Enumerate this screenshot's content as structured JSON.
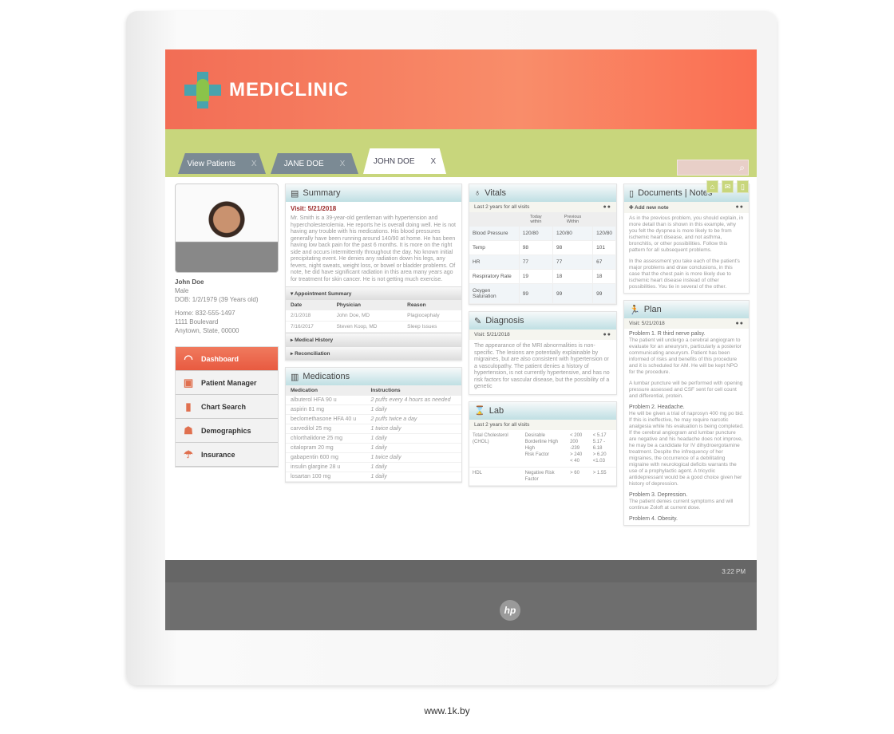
{
  "brand": {
    "name": "MEDICLINIC",
    "colors": {
      "header": "#f26d55",
      "band": "#c8d67c",
      "accent": "#4aa3ad"
    }
  },
  "tabs": [
    {
      "label": "View Patients",
      "close": "X"
    },
    {
      "label": "JANE DOE",
      "close": "X"
    },
    {
      "label": "JOHN DOE",
      "close": "X",
      "active": true
    }
  ],
  "search": {
    "placeholder": "",
    "icon": "search-icon"
  },
  "toolbar": {
    "icons": [
      "home-icon",
      "mail-icon",
      "trash-icon"
    ]
  },
  "patient": {
    "name": "John Doe",
    "sex": "Male",
    "dob": "DOB: 1/2/1979 (39 Years old)",
    "phone": "Home: 832-555-1497",
    "address1": "1111 Boulevard",
    "address2": "Anytown, State, 00000"
  },
  "nav": [
    {
      "label": "Dashboard",
      "icon": "gauge-icon",
      "active": true
    },
    {
      "label": "Patient Manager",
      "icon": "patient-manager-icon"
    },
    {
      "label": "Chart Search",
      "icon": "bar-chart-icon"
    },
    {
      "label": "Demographics",
      "icon": "people-icon"
    },
    {
      "label": "Insurance",
      "icon": "umbrella-icon"
    }
  ],
  "summary": {
    "title": "Summary",
    "visit": "Visit: 5/21/2018",
    "text": "Mr. Smith is a 39-year-old gentleman with hypertension and hypercholesterolemia. He reports he is overall doing well. He is not having any trouble with his medications. His blood pressures generally have been running around 140/90 at home. He has been having low back pain for the past 6 months. It is more on the right side and occurs intermittently throughout the day. No known initial precipitating event. He denies any radiation down his legs, any fevers, night sweats, weight loss, or bowel or bladder problems. Of note, he did have significant radiation in this area many years ago for treatment for skin cancer. He is not getting much exercise.",
    "appointments": {
      "title": "Appointment Summary",
      "columns": [
        "Date",
        "Physician",
        "Reason"
      ],
      "rows": [
        [
          "2/1/2018",
          "John Doe, MD",
          "Plagiocephaly"
        ],
        [
          "7/16/2017",
          "Steven Koop, MD",
          "Sleep Issues"
        ]
      ]
    },
    "medical_history": "Medical History",
    "reconciliation": "Reconciliation"
  },
  "medications": {
    "title": "Medications",
    "columns": [
      "Medication",
      "Instructions"
    ],
    "rows": [
      [
        "albuterol HFA 90 u",
        "2 puffs every 4 hours as needed"
      ],
      [
        "aspirin 81 mg",
        "1 daily"
      ],
      [
        "beclomethasone HFA 40 u",
        "2 puffs twice a day"
      ],
      [
        "carvedilol 25 mg",
        "1 twice daily"
      ],
      [
        "chlorthalidone 25 mg",
        "1 daily"
      ],
      [
        "citalopram 20 mg",
        "1 daily"
      ],
      [
        "gabapentin 600 mg",
        "1 twice daily"
      ],
      [
        "insulin glargine 28 u",
        "1 daily"
      ],
      [
        "losartan 100 mg",
        "1 daily"
      ]
    ]
  },
  "vitals": {
    "title": "Vitals",
    "subtitle": "Last 2 years for all visits",
    "columns": [
      "",
      "Today within",
      "Previous Within",
      ""
    ],
    "rows": [
      [
        "Blood Pressure",
        "120/80",
        "120/80",
        "120/80"
      ],
      [
        "Temp",
        "98",
        "98",
        "101"
      ],
      [
        "HR",
        "77",
        "77",
        "67"
      ],
      [
        "Respiratory Rate",
        "19",
        "18",
        "18"
      ],
      [
        "Oxygen Saturation",
        "99",
        "99",
        "99"
      ]
    ]
  },
  "diagnosis": {
    "title": "Diagnosis",
    "visit": "Visit: 5/21/2018",
    "text": "The appearance of the MRI abnormalities is non-specific. The lesions are potentially explainable by migraines, but are also consistent with hypertension or a vasculopathy. The patient denies a history of hypertension, is not currently hypertensive, and has no risk factors for vascular disease, but the possibility of a genetic"
  },
  "lab": {
    "title": "Lab",
    "subtitle": "Last 2 years for all visits",
    "rows": [
      {
        "test": "Total Cholesterol (CHOL)",
        "levels": "Desirable\nBorderline High\nHigh\nRisk Factor",
        "mg": "< 200\n200 -239\n> 240\n< 40",
        "mmol": "< 5.17\n5.17 - 6.18\n> 6.20\n<1.03"
      },
      {
        "test": "HDL",
        "levels": "Negative Risk Factor",
        "mg": "> 60",
        "mmol": "> 1.55"
      }
    ]
  },
  "documents": {
    "title": "Documents | Notes",
    "add": "Add new note",
    "p1": "As in the previous problem, you should explain, in more detail than is shown in this example, why you felt the dyspnea is more likely to be from ischemic heart disease, and not asthma, bronchitis, or other possibilities. Follow this pattern for all subsequent problems.",
    "p2": "In the assessment you take each of the patient's major problems and draw conclusions, in this case that the chest pain is more likely due to ischemic heart disease instead of other possibilities. You tie in several of the other."
  },
  "plan": {
    "title": "Plan",
    "visit": "Visit: 5/21/2018",
    "items": [
      {
        "h": "Problem 1. R third nerve palsy.",
        "t": "The patient will undergo a cerebral angiogram to evaluate for an aneurysm, particularly a posterior communicating aneurysm. Patient has been informed of risks and benefits of this procedure and it is scheduled for AM. He will be kept NPO for the procedure."
      },
      {
        "h": "",
        "t": "A lumbar puncture will be performed with opening pressure assessed and CSF sent for cell count and differential, protein."
      },
      {
        "h": "Problem 2. Headache.",
        "t": "He will be given a trial of naprosyn 400 mg po bid. If this is ineffective, he may require narcotic analgesia while his evaluation is being completed. If the cerebral angiogram and lumbar puncture are negative and his headache does not improve, he may be a candidate for IV dihydroergotamine treatment. Despite the infrequency of her migraines, the occurrence of a debilitating migraine with neurological deficits warrants the use of a prophylactic agent. A tricyclic antidepressant would be a good choice given her history of depression."
      },
      {
        "h": "Problem 3. Depression.",
        "t": "The patient denies current symptoms and will continue Zoloft at current dose."
      },
      {
        "h": "Problem 4. Obesity.",
        "t": ""
      }
    ]
  },
  "status": {
    "time": "3:22 PM"
  },
  "device": {
    "logo": "hp",
    "watermark": "www.1k.by"
  }
}
